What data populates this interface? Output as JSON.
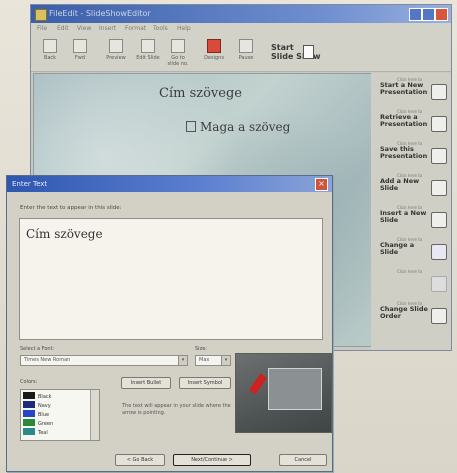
{
  "main_window": {
    "title": "FileEdit - SlideShowEditor",
    "menu": [
      "File",
      "Edit",
      "View",
      "Insert",
      "Format",
      "Tools",
      "Help"
    ],
    "toolbar": [
      {
        "label": "Back",
        "icon": "back-arrow-icon"
      },
      {
        "label": "Fwd",
        "icon": "forward-arrow-icon"
      },
      {
        "label": "Preview",
        "icon": "preview-icon"
      },
      {
        "label": "Edit Slide",
        "icon": "edit-slide-icon"
      },
      {
        "label": "Go to slide no.",
        "icon": "goto-slide-icon"
      },
      {
        "label": "Designs",
        "icon": "designs-icon"
      },
      {
        "label": "Pause",
        "icon": "pause-icon"
      }
    ],
    "start_slide_show": "Start\nSlide Show",
    "slide": {
      "title": "Cím szövege",
      "body": "Maga a szöveg"
    },
    "right_panel": [
      {
        "small": "Click here to",
        "label": "Start a New Presentation",
        "icon": "new-presentation-icon",
        "disabled": false
      },
      {
        "small": "Click here to",
        "label": "Retrieve a Presentation",
        "icon": "retrieve-icon",
        "disabled": false
      },
      {
        "small": "Click here to",
        "label": "Save this Presentation",
        "icon": "save-icon",
        "disabled": false
      },
      {
        "small": "Click here to",
        "label": "Add a New Slide",
        "icon": "add-slide-icon",
        "disabled": false
      },
      {
        "small": "Click here to",
        "label": "Insert a New Slide",
        "icon": "insert-slide-icon",
        "disabled": false
      },
      {
        "small": "Click here to",
        "label": "Change a Slide",
        "icon": "change-slide-icon",
        "disabled": false
      },
      {
        "small": "Click here to",
        "label": "",
        "icon": "disabled-action-icon",
        "disabled": true
      },
      {
        "small": "Click here to",
        "label": "Change Slide Order",
        "icon": "slide-order-icon",
        "disabled": false
      }
    ]
  },
  "dialog": {
    "title": "Enter Text",
    "instruction": "Enter the text to appear in this slide:",
    "text_value": "Cím szövege",
    "font_label": "Select a Font:",
    "font_value": "Times New Roman",
    "size_label": "Size:",
    "size_value": "Max",
    "colors_label": "Colors:",
    "colors": [
      {
        "name": "Black",
        "hex": "#1a1a1a"
      },
      {
        "name": "Navy",
        "hex": "#1e2a7a"
      },
      {
        "name": "Blue",
        "hex": "#2846c8"
      },
      {
        "name": "Green",
        "hex": "#2a8a3a"
      },
      {
        "name": "Teal",
        "hex": "#2a8a8a"
      }
    ],
    "insert_bullet": "Insert Bullet",
    "insert_symbol": "Insert Symbol",
    "help_text": "The text will appear in your slide where the arrow is pointing.",
    "back_btn": "< Go Back",
    "next_btn": "Next/Continue >",
    "cancel_btn": "Cancel"
  }
}
